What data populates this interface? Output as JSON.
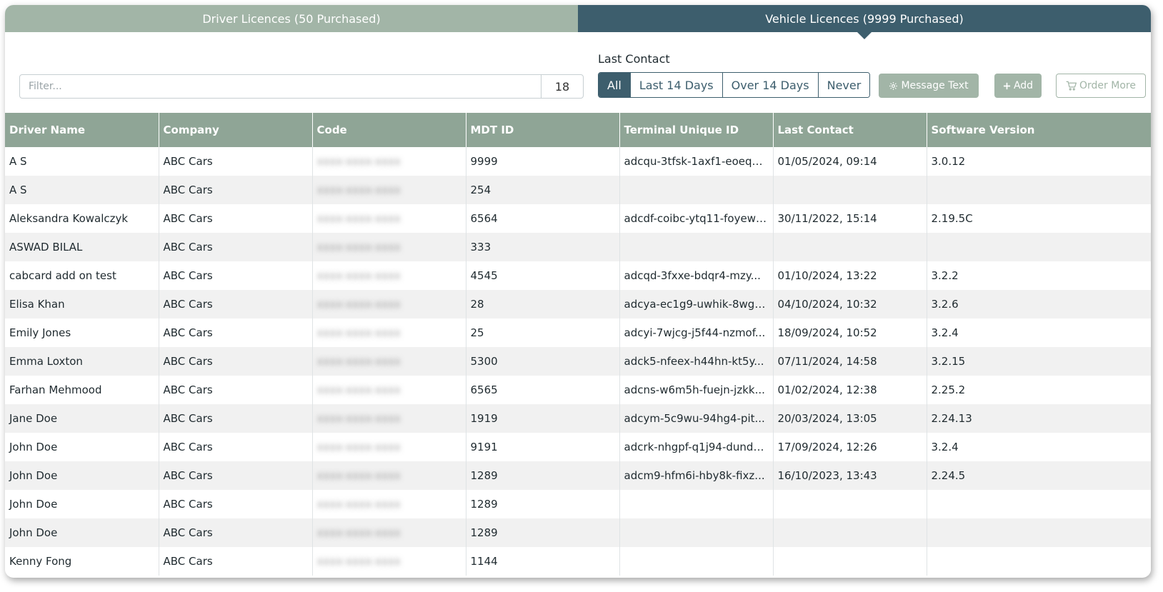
{
  "tabs": [
    {
      "label": "Driver Licences (50 Purchased)",
      "active": false
    },
    {
      "label": "Vehicle Licences (9999 Purchased)",
      "active": true
    }
  ],
  "filter": {
    "placeholder": "Filter...",
    "value": "",
    "count": "18"
  },
  "last_contact": {
    "label": "Last Contact",
    "options": [
      "All",
      "Last 14 Days",
      "Over 14 Days",
      "Never"
    ],
    "selected": "All"
  },
  "buttons": {
    "message_text": "Message Text",
    "add": "Add",
    "order_more": "Order More"
  },
  "icons": {
    "message_text": "gear-icon",
    "add": "plus-icon",
    "order_more": "cart-icon"
  },
  "colors": {
    "tab_inactive": "#a2b5a7",
    "tab_active": "#3d5e6d",
    "header_bg": "#8fa596",
    "accent": "#3d5e6d"
  },
  "table": {
    "columns": [
      "Driver Name",
      "Company",
      "Code",
      "MDT ID",
      "Terminal Unique ID",
      "Last Contact",
      "Software Version"
    ],
    "rows": [
      [
        "A S",
        "ABC Cars",
        "xxxx-xxxx-xxxx",
        "9999",
        "adcqu-3tfsk-1axf1-eoeq6-...",
        "01/05/2024, 09:14",
        "3.0.12"
      ],
      [
        "A S",
        "ABC Cars",
        "xxxx-xxxx-xxxx",
        "254",
        "",
        "",
        ""
      ],
      [
        "Aleksandra Kowalczyk",
        "ABC Cars",
        "xxxx-xxxx-xxxx",
        "6564",
        "adcdf-coibc-ytq11-foyew-...",
        "30/11/2022, 15:14",
        "2.19.5C"
      ],
      [
        "ASWAD BILAL",
        "ABC Cars",
        "xxxx-xxxx-xxxx",
        "333",
        "",
        "",
        ""
      ],
      [
        "cabcard add on test",
        "ABC Cars",
        "xxxx-xxxx-xxxx",
        "4545",
        "adcqd-3fxxe-bdqr4-mzy...",
        "01/10/2024, 13:22",
        "3.2.2"
      ],
      [
        "Elisa Khan",
        "ABC Cars",
        "xxxx-xxxx-xxxx",
        "28",
        "adcya-ec1g9-uwhik-8wgq...",
        "04/10/2024, 10:32",
        "3.2.6"
      ],
      [
        "Emily Jones",
        "ABC Cars",
        "xxxx-xxxx-xxxx",
        "25",
        "adcyi-7wjcg-j5f44-nzmof...",
        "18/09/2024, 10:52",
        "3.2.4"
      ],
      [
        "Emma Loxton",
        "ABC Cars",
        "xxxx-xxxx-xxxx",
        "5300",
        "adck5-nfeex-h44hn-kt5y...",
        "07/11/2024, 14:58",
        "3.2.15"
      ],
      [
        "Farhan Mehmood",
        "ABC Cars",
        "xxxx-xxxx-xxxx",
        "6565",
        "adcns-w6m5h-fuejn-jzkk...",
        "01/02/2024, 12:38",
        "2.25.2"
      ],
      [
        "Jane Doe",
        "ABC Cars",
        "xxxx-xxxx-xxxx",
        "1919",
        "adcym-5c9wu-94hg4-pit...",
        "20/03/2024, 13:05",
        "2.24.13"
      ],
      [
        "John Doe",
        "ABC Cars",
        "xxxx-xxxx-xxxx",
        "9191",
        "adcrk-nhgpf-q1j94-dund9...",
        "17/09/2024, 12:26",
        "3.2.4"
      ],
      [
        "John Doe",
        "ABC Cars",
        "xxxx-xxxx-xxxx",
        "1289",
        "adcm9-hfm6i-hby8k-fixz...",
        "16/10/2023, 13:43",
        "2.24.5"
      ],
      [
        "John Doe",
        "ABC Cars",
        "xxxx-xxxx-xxxx",
        "1289",
        "",
        "",
        ""
      ],
      [
        "John Doe",
        "ABC Cars",
        "xxxx-xxxx-xxxx",
        "1289",
        "",
        "",
        ""
      ],
      [
        "Kenny Fong",
        "ABC Cars",
        "xxxx-xxxx-xxxx",
        "1144",
        "",
        "",
        ""
      ]
    ]
  }
}
